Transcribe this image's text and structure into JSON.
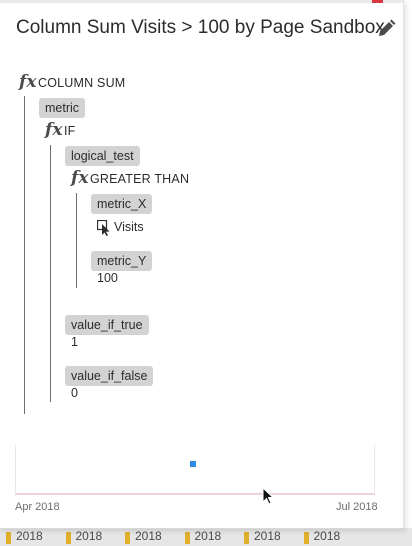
{
  "title": "Column Sum Visits > 100 by Page Sandbox",
  "icons": {
    "edit": "pencil-icon",
    "function": "fx-icon",
    "metric": "cursor-icon"
  },
  "fx_symbol": "fx",
  "formula": {
    "fn1": "COLUMN SUM",
    "param_metric": "metric",
    "fn2": "IF",
    "param_logical_test": "logical_test",
    "fn3": "GREATER THAN",
    "param_metric_x": "metric_X",
    "metric_x_value": "Visits",
    "param_metric_y": "metric_Y",
    "metric_y_value": "100",
    "param_value_if_true": "value_if_true",
    "value_if_true": "1",
    "param_value_if_false": "value_if_false",
    "value_if_false": "0"
  },
  "chart": {
    "start_label": "Apr 2018",
    "end_label": "Jul 2018",
    "series_color": "#2d8ae0",
    "points": [
      {
        "x": "2018-05-16",
        "y": 1
      }
    ]
  },
  "background_strip": [
    "2018",
    "2018",
    "2018",
    "2018",
    "2018",
    "2018"
  ]
}
